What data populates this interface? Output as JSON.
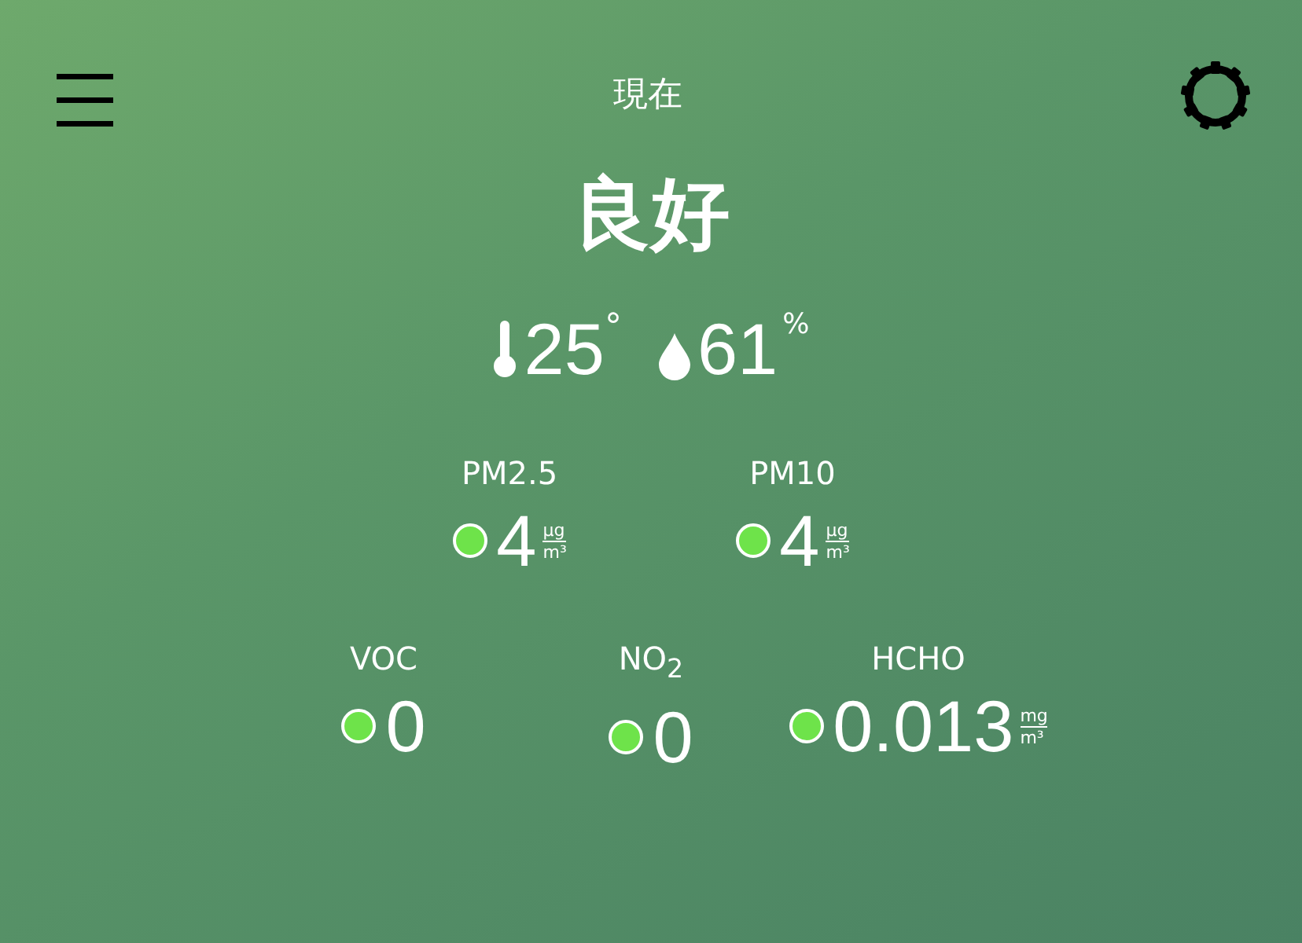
{
  "header": {
    "title": "現在"
  },
  "status": "良好",
  "climate": {
    "temperature": "25",
    "temperature_unit": "°",
    "humidity": "61",
    "humidity_unit": "%"
  },
  "particles": [
    {
      "name": "PM2.5",
      "value": "4",
      "unit_top": "μg",
      "unit_bottom": "m³",
      "color": "#6ee34a"
    },
    {
      "name": "PM10",
      "value": "4",
      "unit_top": "μg",
      "unit_bottom": "m³",
      "color": "#6ee34a"
    }
  ],
  "gases": [
    {
      "name": "VOC",
      "value": "0",
      "color": "#6ee34a"
    },
    {
      "name": "NO$_{2}$",
      "value": "0",
      "color": "#6ee34a"
    },
    {
      "name": "HCHO",
      "value": "0.013",
      "unit_top": "mg",
      "unit_bottom": "m³",
      "color": "#6ee34a"
    }
  ]
}
